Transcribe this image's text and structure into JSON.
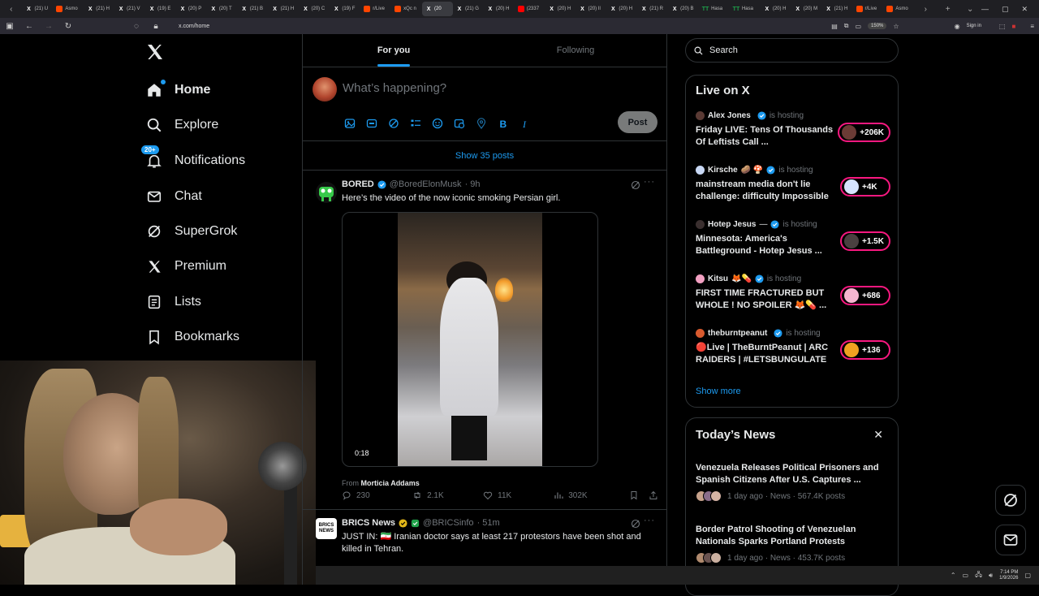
{
  "browser": {
    "tabs": [
      {
        "label": "(21) U",
        "icon": "x-logo-icon"
      },
      {
        "label": "Asmo",
        "icon": "reddit-icon"
      },
      {
        "label": "(21) H",
        "icon": "x-logo-icon"
      },
      {
        "label": "(21) V",
        "icon": "x-logo-icon"
      },
      {
        "label": "(19) E",
        "icon": "x-logo-icon"
      },
      {
        "label": "(20) P",
        "icon": "x-logo-icon"
      },
      {
        "label": "(20) T",
        "icon": "x-logo-icon"
      },
      {
        "label": "(21) B",
        "icon": "x-logo-icon"
      },
      {
        "label": "(21) H",
        "icon": "x-logo-icon"
      },
      {
        "label": "(20) C",
        "icon": "x-logo-icon"
      },
      {
        "label": "(19) F",
        "icon": "x-logo-icon"
      },
      {
        "label": "r/Live",
        "icon": "reddit-icon"
      },
      {
        "label": "xQc n",
        "icon": "reddit-icon"
      },
      {
        "label": "(20",
        "icon": "x-logo-icon",
        "active": true
      },
      {
        "label": "(21) G",
        "icon": "x-logo-icon"
      },
      {
        "label": "(20) H",
        "icon": "x-logo-icon"
      },
      {
        "label": "(2337",
        "icon": "youtube-icon"
      },
      {
        "label": "(20) H",
        "icon": "x-logo-icon"
      },
      {
        "label": "(20) Il",
        "icon": "x-logo-icon"
      },
      {
        "label": "(20) H",
        "icon": "x-logo-icon"
      },
      {
        "label": "(21) R",
        "icon": "x-logo-icon"
      },
      {
        "label": "(20) B",
        "icon": "x-logo-icon"
      },
      {
        "label": "Hasa",
        "icon": "tt-icon"
      },
      {
        "label": "Hasa",
        "icon": "tt-icon"
      },
      {
        "label": "(20) H",
        "icon": "x-logo-icon"
      },
      {
        "label": "(20) M",
        "icon": "x-logo-icon"
      },
      {
        "label": "(21) H",
        "icon": "x-logo-icon"
      },
      {
        "label": "r/Live",
        "icon": "reddit-icon"
      },
      {
        "label": "Asmo",
        "icon": "reddit-icon"
      }
    ],
    "url": "x.com/home",
    "zoom": "150%",
    "signin": "Sign in"
  },
  "nav": {
    "items": [
      {
        "label": "Home",
        "icon": "home-icon",
        "active": true
      },
      {
        "label": "Explore",
        "icon": "search-icon"
      },
      {
        "label": "Notifications",
        "icon": "bell-icon",
        "badge": "20+"
      },
      {
        "label": "Chat",
        "icon": "mail-icon"
      },
      {
        "label": "SuperGrok",
        "icon": "grok-icon"
      },
      {
        "label": "Premium",
        "icon": "x-logo-icon"
      },
      {
        "label": "Lists",
        "icon": "list-icon"
      },
      {
        "label": "Bookmarks",
        "icon": "bookmark-icon"
      }
    ]
  },
  "feed": {
    "tabs": [
      "For you",
      "Following"
    ],
    "composer_placeholder": "What’s happening?",
    "post_button": "Post",
    "show_posts": "Show 35 posts",
    "posts": [
      {
        "name": "BORED",
        "handle": "@BoredElonMusk",
        "time": "· 9h",
        "text": "Here’s the video of the now iconic smoking Persian girl.",
        "video_time": "0:18",
        "from_label": "From",
        "from_name": "Morticia Addams",
        "replies": "230",
        "reposts": "2.1K",
        "likes": "11K",
        "views": "302K"
      },
      {
        "name": "BRICS News",
        "handle": "@BRICSinfo",
        "time": "· 51m",
        "avatar_text": "BRICS NEWS",
        "text": "JUST IN: 🇮🇷 Iranian doctor says at least 217 protestors have been shot and killed in Tehran."
      }
    ]
  },
  "search": {
    "placeholder": "Search"
  },
  "live": {
    "title": "Live on X",
    "items": [
      {
        "host": "Alex Jones",
        "emoji": "",
        "hosting": "is hosting",
        "title": "Friday LIVE: Tens Of Thousands Of Leftists Call ...",
        "count": "+206K"
      },
      {
        "host": "Kirsche",
        "emoji": "🥔 🍄",
        "hosting": "is hosting",
        "title": "mainstream media don't lie challenge: difficulty Impossible",
        "count": "+4K"
      },
      {
        "host": "Hotep Jesus",
        "emoji": "—",
        "hosting": "is hosting",
        "title": "Minnesota: America's Battleground - Hotep Jesus ...",
        "count": "+1.5K"
      },
      {
        "host": "Kitsu",
        "emoji": "🦊💊",
        "hosting": "is hosting",
        "title": "FIRST TIME FRACTURED BUT WHOLE ! NO SPOILER 🦊💊 ...",
        "count": "+686"
      },
      {
        "host": "theburntpeanut",
        "emoji": "",
        "hosting": "is hosting",
        "title": "🔴Live | TheBurntPeanut | ARC RAIDERS | #LETSBUNGULATE",
        "count": "+136"
      }
    ],
    "show_more": "Show more"
  },
  "news": {
    "title": "Today’s News",
    "items": [
      {
        "headline": "Venezuela Releases Political Prisoners and Spanish Citizens After U.S. Captures ...",
        "meta": "1 day ago · News · 567.4K posts"
      },
      {
        "headline": "Border Patrol Shooting of Venezuelan Nationals Sparks Portland Protests",
        "meta": "1 day ago · News · 453.7K posts"
      }
    ]
  },
  "taskbar": {
    "time": "7:14 PM",
    "date": "1/9/2026"
  },
  "colors": {
    "accent": "#1d9bf0",
    "live": "#f91880",
    "border": "#2f3336",
    "muted": "#71767b"
  }
}
